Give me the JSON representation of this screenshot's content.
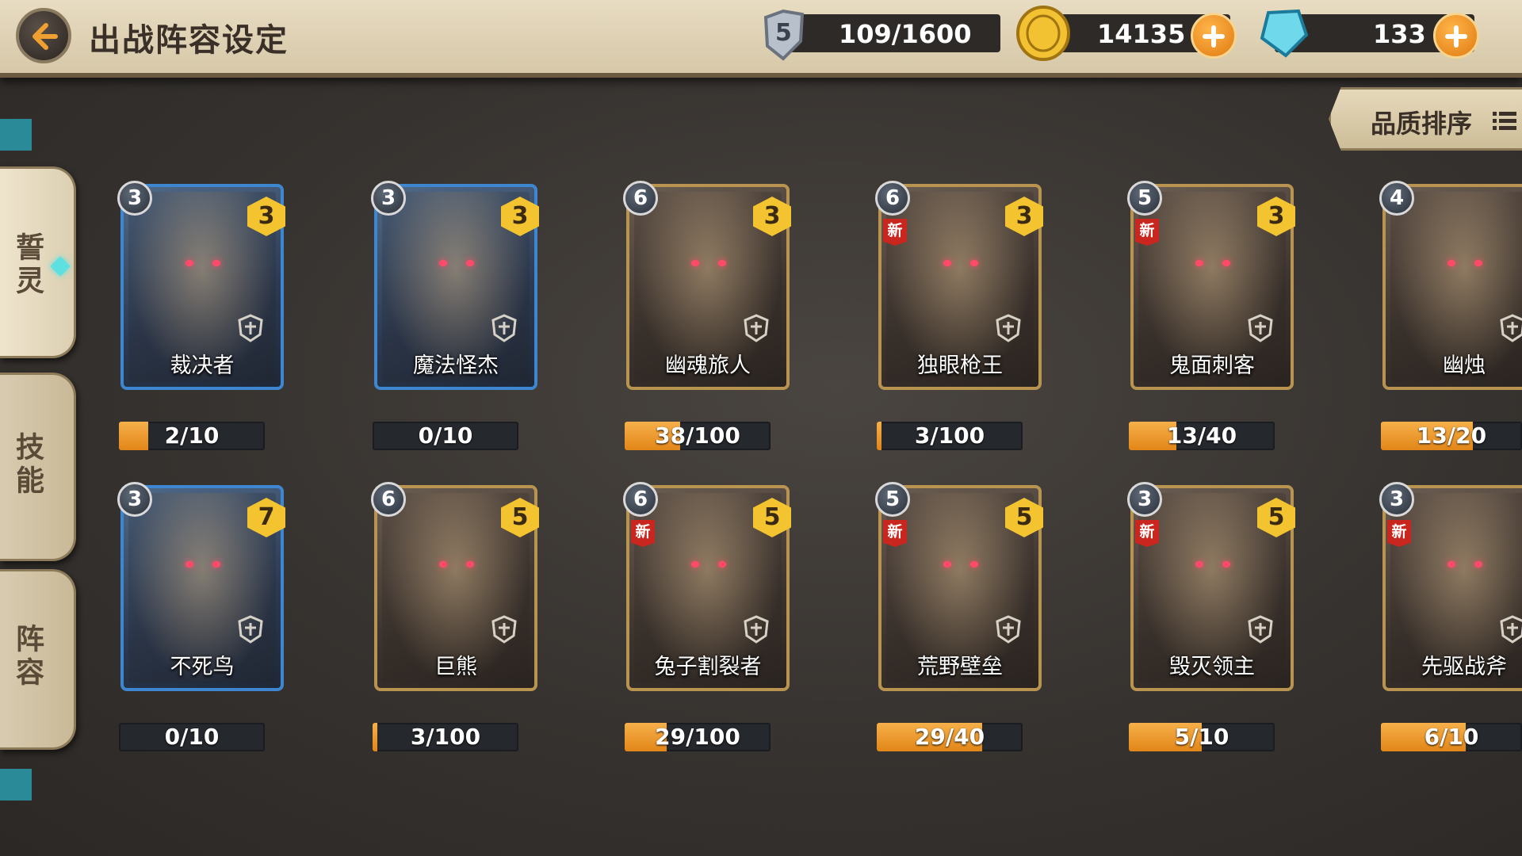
{
  "header": {
    "title": "出战阵容设定",
    "level": "5",
    "experience": "109/1600",
    "gold": "14135",
    "gems": "133"
  },
  "sidebar": {
    "tabs": [
      {
        "label": "誓灵"
      },
      {
        "label": "技能"
      },
      {
        "label": "阵容"
      }
    ]
  },
  "sort": {
    "label": "品质排序"
  },
  "heroes": [
    {
      "name": "裁决者",
      "stars": "3",
      "cost": "3",
      "new": false,
      "progress": "2/10",
      "fill": 0.2,
      "frame": "blue"
    },
    {
      "name": "魔法怪杰",
      "stars": "3",
      "cost": "3",
      "new": false,
      "progress": "0/10",
      "fill": 0.0,
      "frame": "blue"
    },
    {
      "name": "幽魂旅人",
      "stars": "6",
      "cost": "3",
      "new": false,
      "progress": "38/100",
      "fill": 0.38,
      "frame": "gold"
    },
    {
      "name": "独眼枪王",
      "stars": "6",
      "cost": "3",
      "new": true,
      "progress": "3/100",
      "fill": 0.03,
      "frame": "gold"
    },
    {
      "name": "鬼面刺客",
      "stars": "5",
      "cost": "3",
      "new": true,
      "progress": "13/40",
      "fill": 0.325,
      "frame": "gold"
    },
    {
      "name": "幽烛",
      "stars": "4",
      "cost": "",
      "new": false,
      "progress": "13/20",
      "fill": 0.65,
      "frame": "gold"
    },
    {
      "name": "不死鸟",
      "stars": "3",
      "cost": "7",
      "new": false,
      "progress": "0/10",
      "fill": 0.0,
      "frame": "blue"
    },
    {
      "name": "巨熊",
      "stars": "6",
      "cost": "5",
      "new": false,
      "progress": "3/100",
      "fill": 0.03,
      "frame": "gold"
    },
    {
      "name": "兔子割裂者",
      "stars": "6",
      "cost": "5",
      "new": true,
      "progress": "29/100",
      "fill": 0.29,
      "frame": "gold"
    },
    {
      "name": "荒野壁垒",
      "stars": "5",
      "cost": "5",
      "new": true,
      "progress": "29/40",
      "fill": 0.725,
      "frame": "gold"
    },
    {
      "name": "毁灭领主",
      "stars": "3",
      "cost": "5",
      "new": true,
      "progress": "5/10",
      "fill": 0.5,
      "frame": "gold"
    },
    {
      "name": "先驱战斧",
      "stars": "3",
      "cost": "",
      "new": true,
      "progress": "6/10",
      "fill": 0.6,
      "frame": "gold"
    }
  ],
  "new_tag": "新",
  "colors": {
    "progress_fill": "#e99a2a",
    "blue_frame": "#3f86d0",
    "gold_frame": "#b89450"
  }
}
